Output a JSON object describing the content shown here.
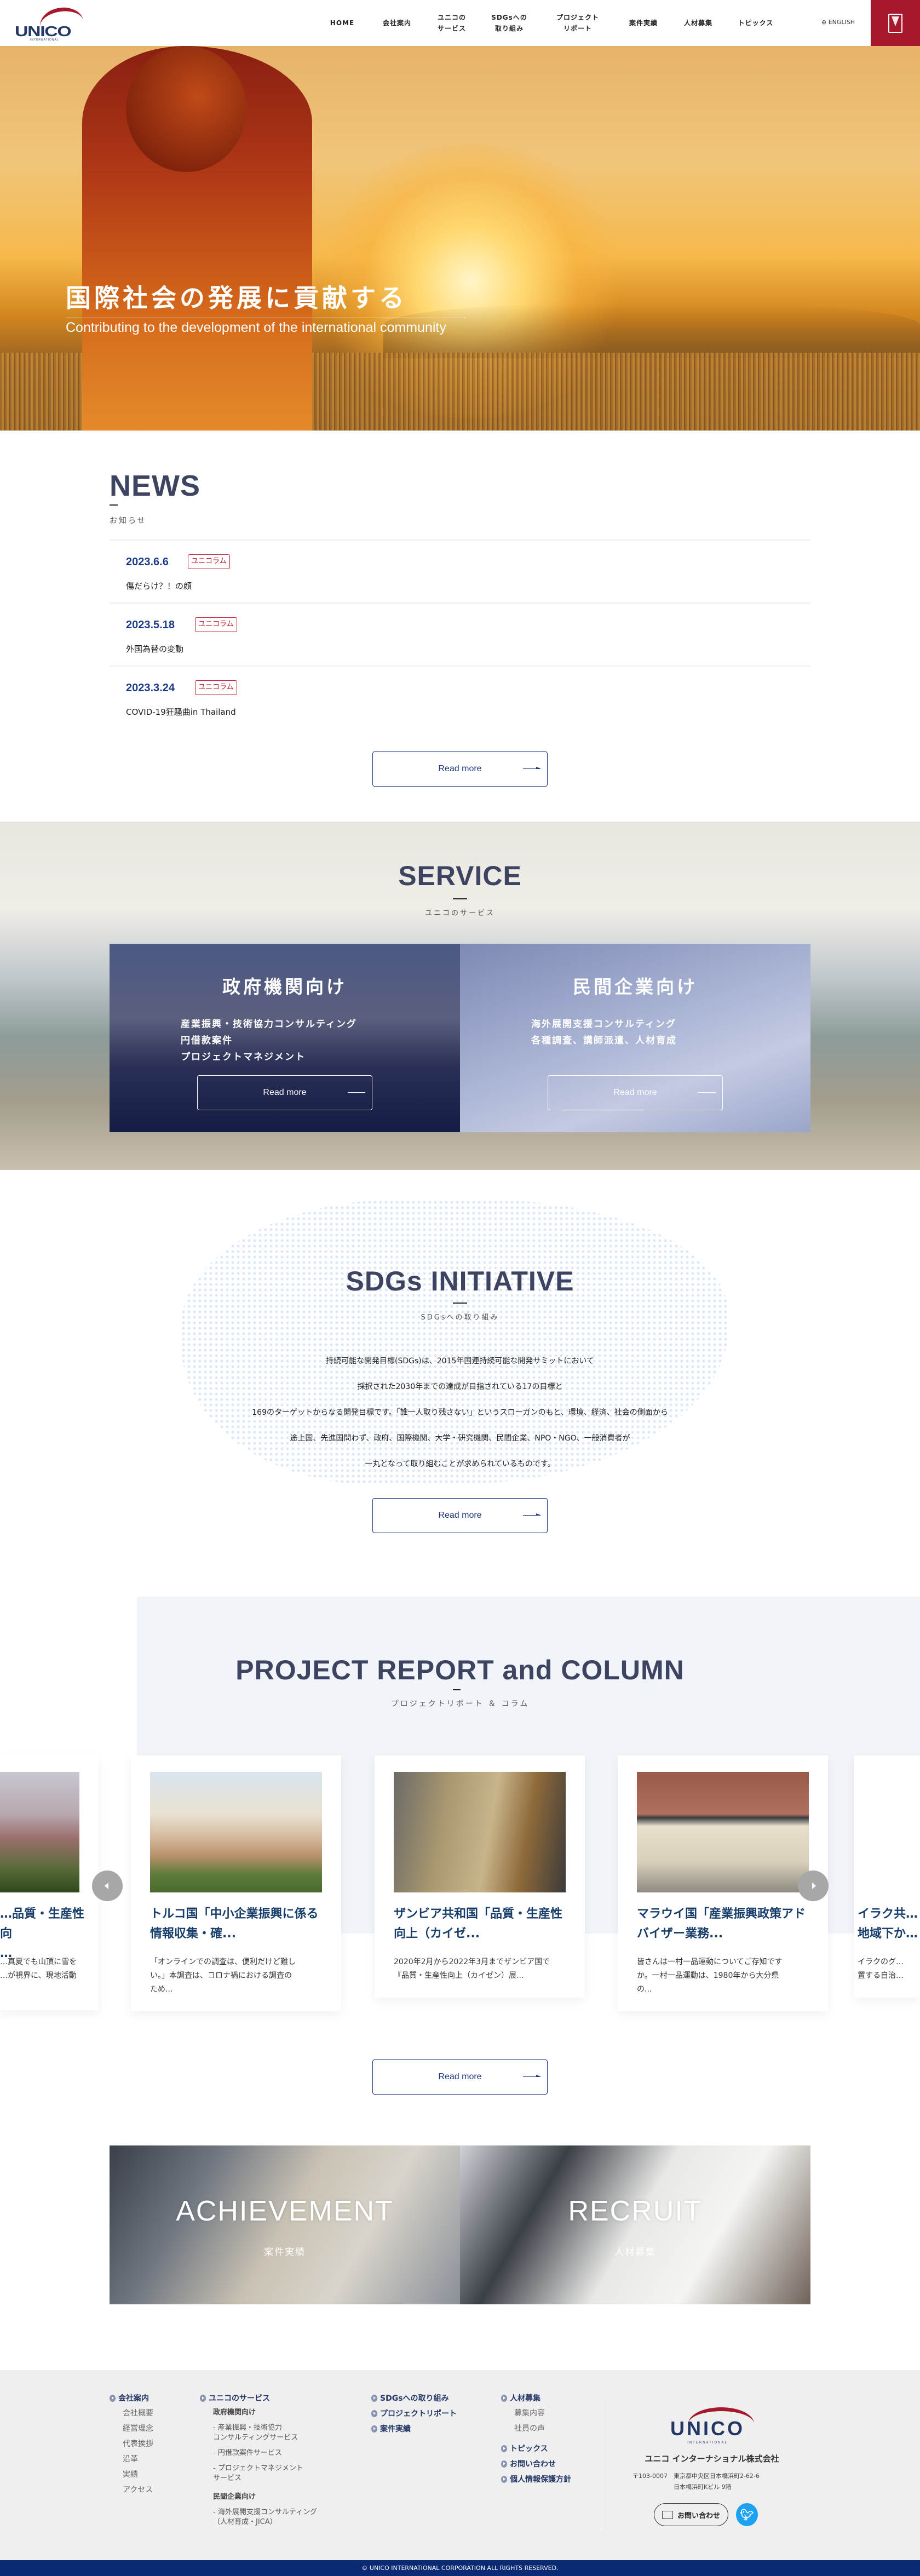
{
  "header": {
    "logo_text": "UNICO",
    "logo_sub": "INTERNATIONAL",
    "nav": [
      {
        "label": "HOME"
      },
      {
        "label": "会社案内"
      },
      {
        "label": "ユニコの\nサービス"
      },
      {
        "label": "SDGsへの\n取り組み"
      },
      {
        "label": "プロジェクト\nリポート"
      },
      {
        "label": "案件実績"
      },
      {
        "label": "人材募集"
      },
      {
        "label": "トピックス"
      }
    ],
    "language": "ENGLISH",
    "menu_icon": "mail-menu-icon",
    "accent": "#a8182c"
  },
  "hero": {
    "title": "国際社会の発展に貢献する",
    "subtitle": "Contributing to the development of the international community"
  },
  "news": {
    "title": "NEWS",
    "subtitle": "お知らせ",
    "items": [
      {
        "date": "2023.6.6",
        "tag": "ユニコラム",
        "title": "傷だらけ？！の顔"
      },
      {
        "date": "2023.5.18",
        "tag": "ユニコラム",
        "title": "外国為替の変動"
      },
      {
        "date": "2023.3.24",
        "tag": "ユニコラム",
        "title": "COVID-19狂騒曲in Thailand"
      }
    ],
    "read_more": "Read more"
  },
  "service": {
    "title": "SERVICE",
    "subtitle": "ユニコのサービス",
    "cards": [
      {
        "title": "政府機関向け",
        "items": [
          "産業振興・技術協力コンサルティング",
          "円借款案件",
          "プロジェクトマネジメント"
        ],
        "read_more": "Read more"
      },
      {
        "title": "民間企業向け",
        "items": [
          "海外展開支援コンサルティング",
          "各種調査、講師派遣、人材育成"
        ],
        "read_more": "Read more"
      }
    ]
  },
  "sdgs": {
    "title": "SDGs INITIATIVE",
    "subtitle": "SDGsへの取り組み",
    "lines": [
      "持続可能な開発目標(SDGs)は、2015年国連持続可能な開発サミットにおいて",
      "採択された2030年までの達成が目指されている17の目標と",
      "169のターゲットからなる開発目標です。「誰一人取り残さない」というスローガンのもと、環境、経済、社会の側面から",
      "途上国、先進国問わず、政府、国際機関、大学・研究機関、民間企業、NPO・NGO、一般消費者が",
      "一丸となって取り組むことが求められているものです。"
    ],
    "read_more": "Read more"
  },
  "projects": {
    "title": "PROJECT REPORT and COLUMN",
    "subtitle": "プロジェクトリポート ＆ コラム",
    "cards": [
      {
        "title": "…品質・生産性向\n…",
        "excerpt": "…真夏でも山頂に雪を\n…が視界に、現地活動"
      },
      {
        "title": "トルコ国「中小企業振興に係る\n情報収集・確...",
        "excerpt": "「オンラインでの調査は、便利だけど難し\nい。」本調査は、コロナ禍における調査の\nため..."
      },
      {
        "title": "ザンビア共和国「品質・生産性\n向上（カイゼ...",
        "excerpt": "2020年2月から2022年3月までザンビア国で\n『品質・生産性向上（カイゼン）展..."
      },
      {
        "title": "マラウイ国「産業振興政策アド\nバイザー業務...",
        "excerpt": "皆さんは一村一品運動についてご存知です\nか。一村一品運動は、1980年から大分県\nの..."
      },
      {
        "title": "イラク共…\n地域下か…",
        "excerpt": "イラクのグ…\n置する自治…"
      }
    ],
    "read_more": "Read more"
  },
  "banners": [
    {
      "title": "ACHIEVEMENT",
      "subtitle": "案件実績"
    },
    {
      "title": "RECRUIT",
      "subtitle": "人材募集"
    }
  ],
  "footer": {
    "company": {
      "head": "会社案内",
      "items": [
        "会社概要",
        "経営理念",
        "代表挨拶",
        "沿革",
        "実績",
        "アクセス"
      ]
    },
    "services": {
      "head": "ユニコのサービス",
      "gov_head": "政府機関向け",
      "gov_items": [
        "- 産業振興・技術協力\n  コンサルティングサービス",
        "- 円借款案件サービス",
        "- プロジェクトマネジメント\n  サービス"
      ],
      "pri_head": "民間企業向け",
      "pri_items": [
        "- 海外展開支援コンサルティング\n  （人材育成・JICA）"
      ]
    },
    "col3": [
      "SDGsへの取り組み",
      "プロジェクトリポート",
      "案件実績"
    ],
    "recruit": {
      "head": "人材募集",
      "items": [
        "募集内容",
        "社員の声"
      ]
    },
    "col4": [
      "トピックス",
      "お問い合わせ",
      "個人情報保護方針"
    ],
    "logo_text": "UNICO",
    "logo_sub": "INTERNATIONAL",
    "company_name": "ユニコ インターナショナル株式会社",
    "address1": "〒103-0007　東京都中央区日本橋浜町2-62-6",
    "address2": "日本橋浜町Kビル 9階",
    "contact_button": "お問い合わせ",
    "twitter_icon": "twitter-icon",
    "copyright": "© UNICO INTERNATIONAL CORPORATION ALL RIGHTS RESERVED."
  }
}
